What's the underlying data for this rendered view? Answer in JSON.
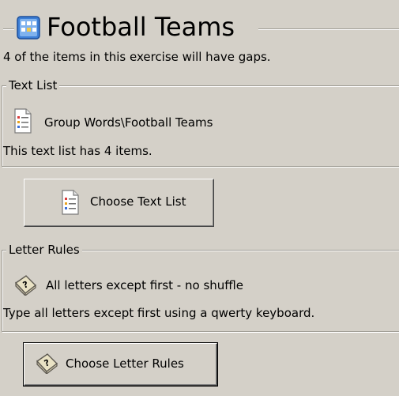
{
  "header": {
    "title": "Football Teams",
    "subtitle": "4 of the items in this exercise will have gaps.",
    "icon": "word-grid-icon"
  },
  "text_list": {
    "legend": "Text List",
    "item_label": "Group Words\\Football Teams",
    "item_icon": "text-list-document-icon",
    "info": "This text list has 4 items.",
    "button_label": "Choose Text List"
  },
  "letter_rules": {
    "legend": "Letter Rules",
    "item_label": "All letters except first - no shuffle",
    "item_icon": "question-key-icon",
    "info": "Type all letters except first using a qwerty keyboard.",
    "button_label": "Choose Letter Rules"
  },
  "colors": {
    "panel_background": "#d4d0c8",
    "title_icon_blue": "#3d7fd6"
  }
}
